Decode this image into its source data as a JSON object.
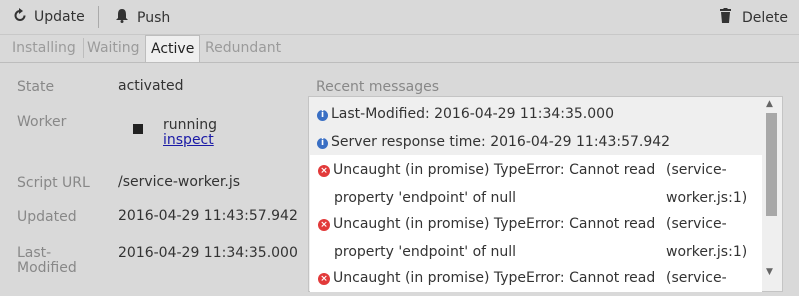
{
  "toolbar": {
    "update_label": "Update",
    "push_label": "Push",
    "delete_label": "Delete"
  },
  "tabs": [
    {
      "label": "Installing",
      "active": false
    },
    {
      "label": "Waiting",
      "active": false
    },
    {
      "label": "Active",
      "active": true
    },
    {
      "label": "Redundant",
      "active": false
    }
  ],
  "details": {
    "state_label": "State",
    "state_value": "activated",
    "worker_label": "Worker",
    "worker_status": "running",
    "worker_link": "inspect",
    "script_url_label": "Script URL",
    "script_url_value": "/service-worker.js",
    "updated_label": "Updated",
    "updated_value": "2016-04-29 11:43:57.942",
    "last_modified_label_1": "Last-",
    "last_modified_label_2": "Modified",
    "last_modified_value": "2016-04-29 11:34:35.000"
  },
  "messages": {
    "title": "Recent messages",
    "info": [
      "Last-Modified: 2016-04-29 11:34:35.000",
      "Server response time: 2016-04-29 11:43:57.942"
    ],
    "errors": [
      {
        "line1": "Uncaught (in promise) TypeError: Cannot read",
        "line2": "property 'endpoint' of null",
        "src1": "(service-",
        "src2": "worker.js:1)"
      },
      {
        "line1": "Uncaught (in promise) TypeError: Cannot read",
        "line2": "property 'endpoint' of null",
        "src1": "(service-",
        "src2": "worker.js:1)"
      },
      {
        "line1": "Uncaught (in promise) TypeError: Cannot read",
        "src1": "(service-"
      }
    ]
  },
  "icons": {
    "update": "refresh-icon",
    "push": "bell-icon",
    "delete": "trash-icon",
    "info": "info-icon",
    "error": "error-icon"
  },
  "colors": {
    "info_icon": "#3a6fc4",
    "error_icon": "#e23a3a",
    "link": "#1a1aa6"
  }
}
